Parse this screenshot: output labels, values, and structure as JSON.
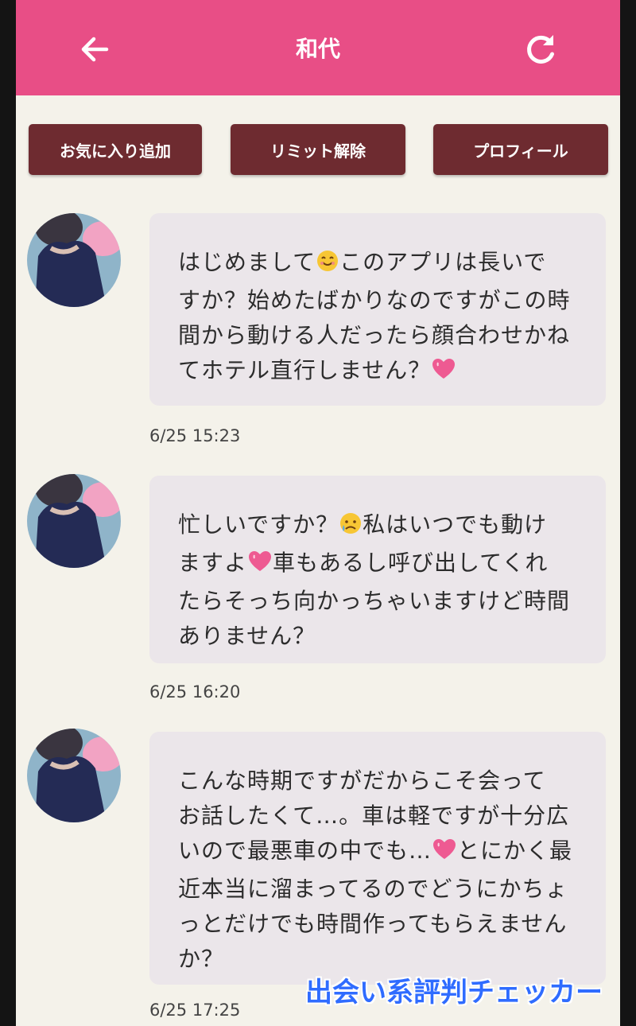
{
  "header": {
    "title": "和代",
    "back_icon": "arrow-left-icon",
    "refresh_icon": "refresh-icon",
    "color": "#e84e86"
  },
  "actions": {
    "favorite": "お気に入り追加",
    "limit": "リミット解除",
    "profile": "プロフィール",
    "color": "#6e2b30"
  },
  "messages": [
    {
      "lines": [
        "はじめまして",
        "このアプリは長いで",
        "すか？始めたばかりなのですがこの時",
        "間から動ける人だったら顔合わせかね",
        "てホテル直行しません？"
      ],
      "emoji": [
        "smiling-face-emoji",
        "pink-heart-emoji"
      ],
      "time": "6/25 15:23"
    },
    {
      "lines": [
        "忙しいですか？",
        "私はいつでも動け",
        "ますよ",
        "車もあるし呼び出してくれ",
        "たらそっち向かっちゃいますけど時間",
        "ありません？"
      ],
      "emoji": [
        "sad-face-emoji",
        "pink-heart-emoji"
      ],
      "time": "6/25 16:20"
    },
    {
      "lines": [
        "こんな時期ですがだからこそ会って",
        "お話したくて…。車は軽ですが十分広",
        "いので最悪車の中でも…",
        "とにかく最",
        "近本当に溜まってるのでどうにかちょ",
        "っとだけでも時間作ってもらえません",
        "か？"
      ],
      "emoji": [
        "pink-heart-emoji"
      ],
      "time": "6/25 17:25"
    }
  ],
  "watermark": "出会い系評判チェッカー"
}
